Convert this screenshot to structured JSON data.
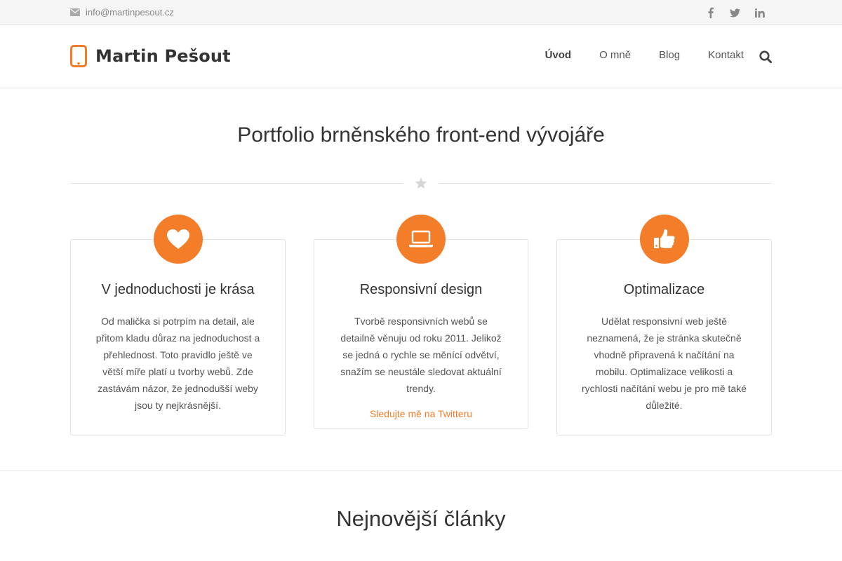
{
  "topbar": {
    "email": "info@martinpesout.cz",
    "icons": [
      "envelope-icon",
      "facebook-icon",
      "twitter-icon",
      "linkedin-icon"
    ]
  },
  "header": {
    "logo_text": "Martin Pešout",
    "nav": [
      {
        "label": "Úvod",
        "active": true
      },
      {
        "label": "O mně",
        "active": false
      },
      {
        "label": "Blog",
        "active": false
      },
      {
        "label": "Kontakt",
        "active": false
      }
    ]
  },
  "hero": {
    "title": "Portfolio brněnského front-end vývojáře"
  },
  "features": [
    {
      "icon": "heart-icon",
      "title": "V jednoduchosti je krása",
      "text": "Od malička si potrpím na detail, ale přitom kladu důraz na jednoduchost a přehlednost. Toto pravidlo ještě ve větší míře platí u tvorby webů. Zde zastávám názor, že jednodušší weby jsou ty nejkrásnější."
    },
    {
      "icon": "laptop-icon",
      "title": "Responsivní design",
      "text": "Tvorbě responsivních webů se detailně věnuju od roku 2011. Jelikož se jedná o rychle se měnící odvětví, snažím se neustále sledovat aktuální trendy.",
      "link": "Sledujte mě na Twitteru"
    },
    {
      "icon": "thumbs-up-icon",
      "title": "Optimalizace",
      "text": "Udělat responsivní web ještě neznamená, že je stránka skutečně vhodně připravená k načítání na mobilu. Optimalizace velikosti a rychlosti načítání webu je pro mě také důležité."
    }
  ],
  "articles": {
    "title": "Nejnovější články"
  },
  "colors": {
    "accent": "#f47d2a",
    "topbar_bg": "#f5f5f5",
    "text": "#333333"
  }
}
